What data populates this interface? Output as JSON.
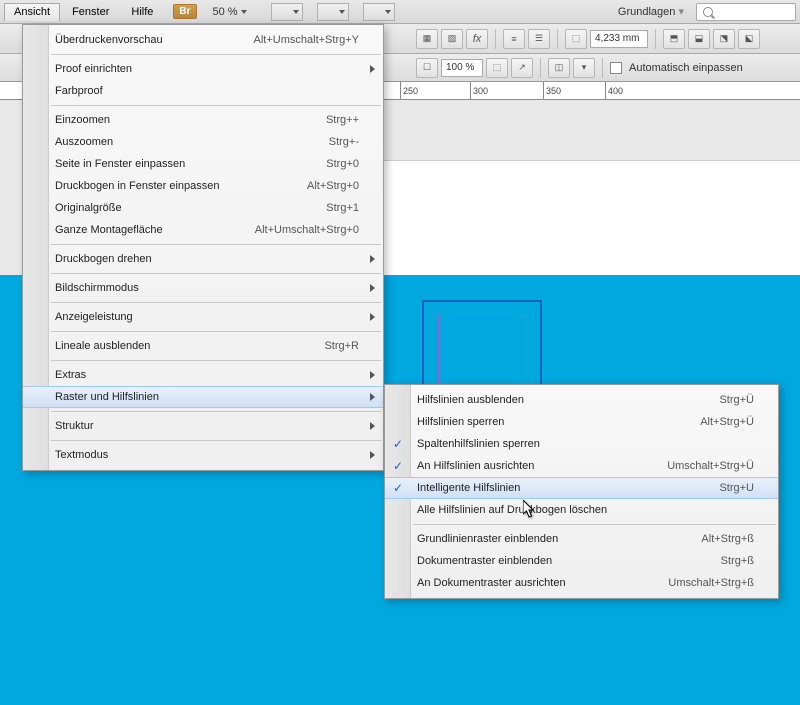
{
  "menubar": {
    "items": [
      "Ansicht",
      "Fenster",
      "Hilfe"
    ],
    "br": "Br",
    "zoom": "50 %",
    "workspace": "Grundlagen"
  },
  "toolbar": {
    "percent": "100 %",
    "measure": "4,233 mm",
    "auto_fit": "Automatisch einpassen"
  },
  "ruler": {
    "marks": [
      {
        "pos": 220,
        "label": "250"
      },
      {
        "pos": 290,
        "label": "300"
      },
      {
        "pos": 363,
        "label": "350"
      },
      {
        "pos": 425,
        "label": "400"
      }
    ]
  },
  "menu": {
    "items": [
      {
        "label": "Überdruckenvorschau",
        "shortcut": "Alt+Umschalt+Strg+Y"
      },
      {
        "sep": true
      },
      {
        "label": "Proof einrichten",
        "submenu": true
      },
      {
        "label": "Farbproof"
      },
      {
        "sep": true
      },
      {
        "label": "Einzoomen",
        "shortcut": "Strg++"
      },
      {
        "label": "Auszoomen",
        "shortcut": "Strg+-"
      },
      {
        "label": "Seite in Fenster einpassen",
        "shortcut": "Strg+0"
      },
      {
        "label": "Druckbogen in Fenster einpassen",
        "shortcut": "Alt+Strg+0"
      },
      {
        "label": "Originalgröße",
        "shortcut": "Strg+1"
      },
      {
        "label": "Ganze Montagefläche",
        "shortcut": "Alt+Umschalt+Strg+0"
      },
      {
        "sep": true
      },
      {
        "label": "Druckbogen drehen",
        "submenu": true
      },
      {
        "sep": true
      },
      {
        "label": "Bildschirmmodus",
        "submenu": true
      },
      {
        "sep": true
      },
      {
        "label": "Anzeigeleistung",
        "submenu": true
      },
      {
        "sep": true
      },
      {
        "label": "Lineale ausblenden",
        "shortcut": "Strg+R"
      },
      {
        "sep": true
      },
      {
        "label": "Extras",
        "submenu": true
      },
      {
        "label": "Raster und Hilfslinien",
        "submenu": true,
        "highlighted": true
      },
      {
        "sep": true
      },
      {
        "label": "Struktur",
        "submenu": true
      },
      {
        "sep": true
      },
      {
        "label": "Textmodus",
        "submenu": true
      }
    ]
  },
  "submenu": {
    "items": [
      {
        "label": "Hilfslinien ausblenden",
        "shortcut": "Strg+Ü"
      },
      {
        "label": "Hilfslinien sperren",
        "shortcut": "Alt+Strg+Ü"
      },
      {
        "label": "Spaltenhilfslinien sperren",
        "checked": true
      },
      {
        "label": "An Hilfslinien ausrichten",
        "shortcut": "Umschalt+Strg+Ü",
        "checked": true
      },
      {
        "label": "Intelligente Hilfslinien",
        "shortcut": "Strg+U",
        "checked": true,
        "highlighted": true
      },
      {
        "label": "Alle Hilfslinien auf Druckbogen löschen"
      },
      {
        "sep": true
      },
      {
        "label": "Grundlinienraster einblenden",
        "shortcut": "Alt+Strg+ß"
      },
      {
        "label": "Dokumentraster einblenden",
        "shortcut": "Strg+ß"
      },
      {
        "label": "An Dokumentraster ausrichten",
        "shortcut": "Umschalt+Strg+ß"
      }
    ]
  }
}
